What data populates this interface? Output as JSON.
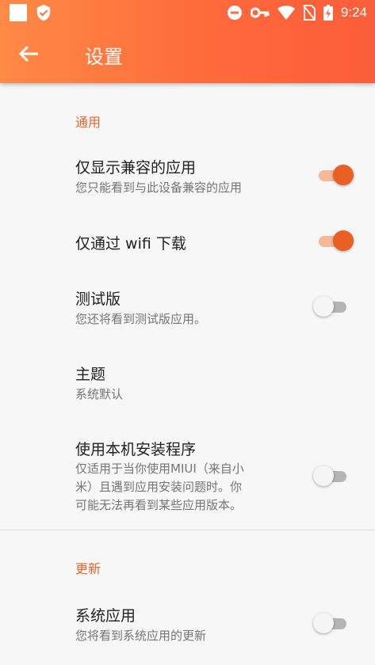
{
  "status_bar": {
    "time": "9:24",
    "icons": [
      "notification-square-icon",
      "shield-check-icon",
      "do-not-disturb-icon",
      "vpn-key-icon",
      "wifi-icon",
      "no-sim-icon",
      "battery-charging-icon"
    ]
  },
  "toolbar": {
    "back_icon": "arrow-left-icon",
    "title": "设置",
    "background_gradient": [
      "#ff8a45",
      "#fb5d3a"
    ]
  },
  "colors": {
    "accent": "#e4672a",
    "switch_on_thumb": "#ea5f23",
    "switch_on_track": "#f6b896",
    "switch_off_thumb": "#f5f5f5",
    "switch_off_track": "#b5b5b5"
  },
  "sections": [
    {
      "header": "通用",
      "items": [
        {
          "title": "仅显示兼容的应用",
          "summary": "您只能看到与此设备兼容的应用",
          "switch": true
        },
        {
          "title": "仅通过 wifi 下载",
          "switch": true
        },
        {
          "title": "测试版",
          "summary": "您还将看到测试版应用。",
          "switch": false
        },
        {
          "title": "主题",
          "summary": "系统默认"
        },
        {
          "title": "使用本机安装程序",
          "summary_lines": [
            "仅适用于当你使用MIUI（来自小",
            "米）且遇到应用安装问题时。你",
            "可能无法再看到某些应用版本。"
          ],
          "switch": false
        }
      ]
    },
    {
      "header": "更新",
      "items": [
        {
          "title": "系统应用",
          "summary": "您将看到系统应用的更新",
          "switch": false
        }
      ]
    }
  ]
}
